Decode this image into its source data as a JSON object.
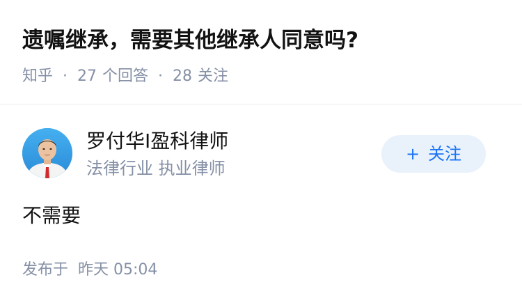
{
  "question": {
    "title": "遗嘱继承，需要其他继承人同意吗?",
    "source": "知乎",
    "answer_count": "27",
    "answer_label": "个回答",
    "follow_count": "28",
    "follow_label": "关注"
  },
  "answer": {
    "author": {
      "name": "罗付华I盈科律师",
      "description": "法律行业 执业律师",
      "avatar_icon": "person-avatar-icon"
    },
    "follow_button": {
      "plus": "+",
      "label": "关注"
    },
    "content": "不需要",
    "published_label": "发布于",
    "published_time": "昨天 05:04"
  },
  "colors": {
    "title": "#121212",
    "meta": "#8590a6",
    "accent": "#1772f6",
    "follow_bg": "#e9f1fb",
    "divider": "#ebebeb"
  }
}
